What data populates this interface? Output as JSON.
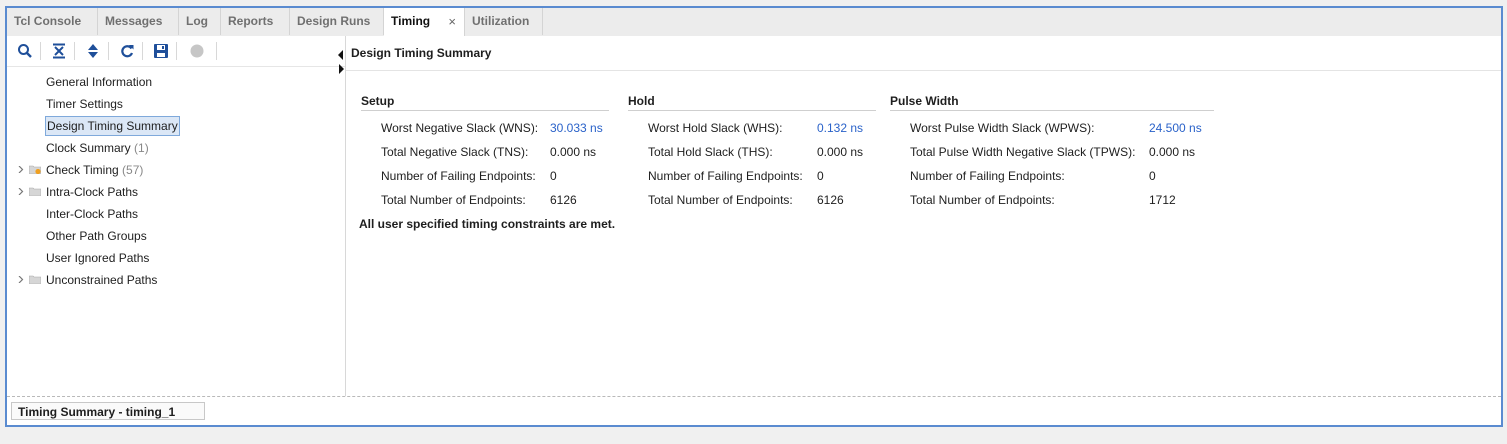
{
  "tabs": [
    {
      "label": "Tcl Console"
    },
    {
      "label": "Messages"
    },
    {
      "label": "Log"
    },
    {
      "label": "Reports"
    },
    {
      "label": "Design Runs"
    },
    {
      "label": "Timing",
      "active": true,
      "close": "×"
    },
    {
      "label": "Utilization"
    }
  ],
  "toolbar_icons": [
    "search-icon",
    "collapse-all-icon",
    "expand-all-icon",
    "refresh-icon",
    "save-icon",
    "stop-icon"
  ],
  "tree": [
    {
      "label": "General Information"
    },
    {
      "label": "Timer Settings"
    },
    {
      "label": "Design Timing Summary",
      "selected": true
    },
    {
      "label": "Clock Summary",
      "count": "(1)"
    },
    {
      "label": "Check Timing",
      "count": "(57)",
      "expandable": true,
      "folder": "warning"
    },
    {
      "label": "Intra-Clock Paths",
      "expandable": true,
      "folder": "plain"
    },
    {
      "label": "Inter-Clock Paths"
    },
    {
      "label": "Other Path Groups"
    },
    {
      "label": "User Ignored Paths"
    },
    {
      "label": "Unconstrained Paths",
      "expandable": true,
      "folder": "plain"
    }
  ],
  "main": {
    "title": "Design Timing Summary",
    "setup": {
      "heading": "Setup",
      "rows": [
        {
          "label": "Worst Negative Slack (WNS):",
          "value": "30.033 ns",
          "link": true
        },
        {
          "label": "Total Negative Slack (TNS):",
          "value": "0.000 ns"
        },
        {
          "label": "Number of Failing Endpoints:",
          "value": "0"
        },
        {
          "label": "Total Number of Endpoints:",
          "value": "6126"
        }
      ]
    },
    "hold": {
      "heading": "Hold",
      "rows": [
        {
          "label": "Worst Hold Slack (WHS):",
          "value": "0.132 ns",
          "link": true
        },
        {
          "label": "Total Hold Slack (THS):",
          "value": "0.000 ns"
        },
        {
          "label": "Number of Failing Endpoints:",
          "value": "0"
        },
        {
          "label": "Total Number of Endpoints:",
          "value": "6126"
        }
      ]
    },
    "pulse": {
      "heading": "Pulse Width",
      "rows": [
        {
          "label": "Worst Pulse Width Slack (WPWS):",
          "value": "24.500 ns",
          "link": true
        },
        {
          "label": "Total Pulse Width Negative Slack (TPWS):",
          "value": "0.000 ns"
        },
        {
          "label": "Number of Failing Endpoints:",
          "value": "0"
        },
        {
          "label": "Total Number of Endpoints:",
          "value": "1712"
        }
      ]
    },
    "note": "All user specified timing constraints are met."
  },
  "status_tab": "Timing Summary - timing_1",
  "colors": {
    "accent": "#5a8bd0",
    "link": "#2a62c9",
    "selection": "#dbe7f6"
  }
}
